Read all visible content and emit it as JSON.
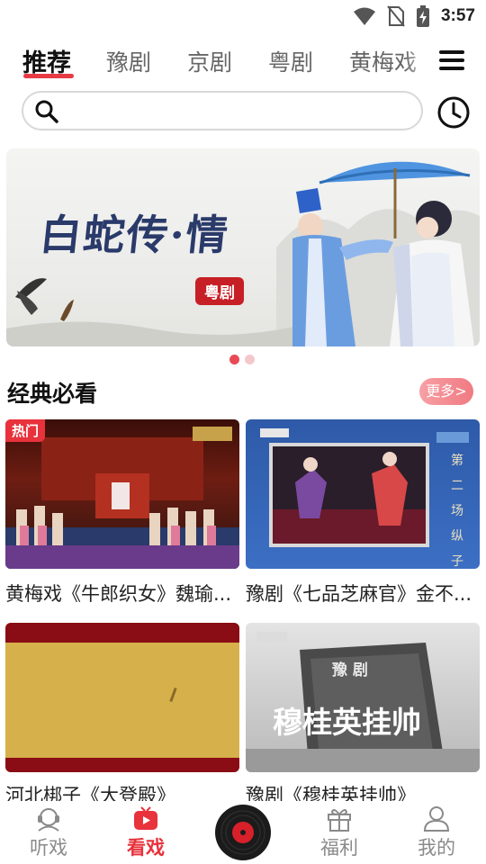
{
  "status": {
    "time": "3:57"
  },
  "tabs": [
    {
      "label": "推荐"
    },
    {
      "label": "豫剧"
    },
    {
      "label": "京剧"
    },
    {
      "label": "粤剧"
    },
    {
      "label": "黄梅戏"
    }
  ],
  "search": {
    "placeholder": ""
  },
  "banner": {
    "title": "白蛇传·情",
    "tag": "粤剧"
  },
  "section": {
    "title": "经典必看",
    "more_label": "更多>"
  },
  "cards": [
    {
      "title": "黄梅戏《牛郎织女》魏瑜...",
      "badge": "热门"
    },
    {
      "title": "豫剧《七品芝麻官》金不..."
    },
    {
      "title": "河北梆子《大登殿》"
    },
    {
      "title": "豫剧《穆桂英挂帅》",
      "thumb_text": "穆桂英挂帅",
      "thumb_small": "豫 剧"
    }
  ],
  "thumb_side_text": "第 二 场 纵 子",
  "nav": [
    {
      "label": "听戏"
    },
    {
      "label": "看戏"
    },
    {
      "label": "福利"
    },
    {
      "label": "我的"
    }
  ],
  "colors": {
    "accent": "#e8323c",
    "badge": "#c62026"
  }
}
